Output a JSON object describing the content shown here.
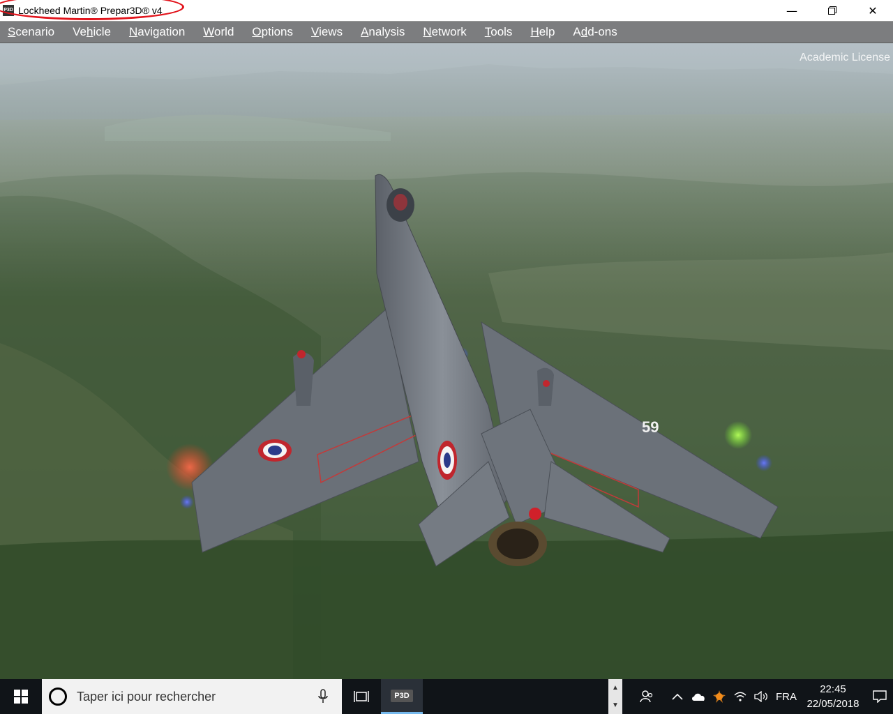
{
  "window": {
    "title": "Lockheed Martin® Prepar3D® v4",
    "icon_label": "P3D",
    "minimize": "—",
    "maximize": "❐",
    "close": "✕"
  },
  "menu": [
    {
      "prefix": "",
      "underline": "S",
      "rest": "cenario"
    },
    {
      "prefix": "Ve",
      "underline": "h",
      "rest": "icle"
    },
    {
      "prefix": "",
      "underline": "N",
      "rest": "avigation"
    },
    {
      "prefix": "",
      "underline": "W",
      "rest": "orld"
    },
    {
      "prefix": "",
      "underline": "O",
      "rest": "ptions"
    },
    {
      "prefix": "",
      "underline": "V",
      "rest": "iews"
    },
    {
      "prefix": "",
      "underline": "A",
      "rest": "nalysis"
    },
    {
      "prefix": "",
      "underline": "N",
      "rest": "etwork"
    },
    {
      "prefix": "",
      "underline": "T",
      "rest": "ools"
    },
    {
      "prefix": "",
      "underline": "H",
      "rest": "elp"
    },
    {
      "prefix": "A",
      "underline": "d",
      "rest": "d-ons"
    }
  ],
  "viewport": {
    "license_text": "Academic License",
    "aircraft_number": "59"
  },
  "taskbar": {
    "search_placeholder": "Taper ici pour rechercher",
    "app_label": "P3D",
    "language": "FRA",
    "time": "22:45",
    "date": "22/05/2018"
  },
  "colors": {
    "accent_red": "#e2141c",
    "menubar": "#7c7d7f",
    "taskbar": "#101418"
  }
}
